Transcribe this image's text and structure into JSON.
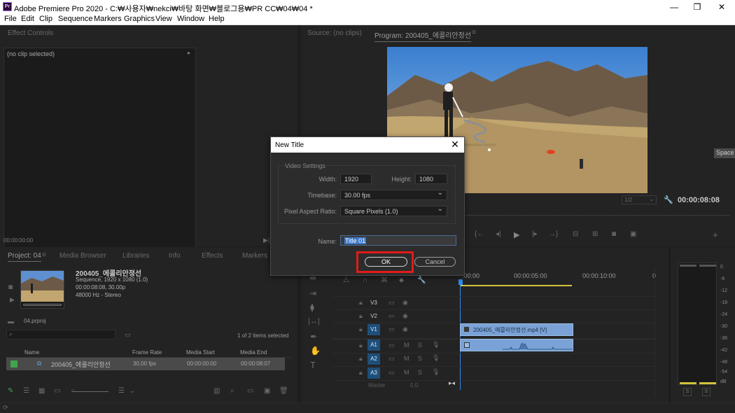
{
  "window": {
    "title": "Adobe Premiere Pro 2020 - C:₩사용자₩nekci₩바탕 화면₩블로그용₩PR CC₩04₩04 *",
    "logo_text": "Pr",
    "minimize": "—",
    "restore": "❐",
    "close": "✕"
  },
  "menu": [
    "File",
    "Edit",
    "Clip",
    "Sequence",
    "Markers",
    "Graphics",
    "View",
    "Window",
    "Help"
  ],
  "effect_controls": {
    "tab": "Effect Controls",
    "no_clip": "(no clip selected)",
    "timecode": "00:00:00:00"
  },
  "program": {
    "source_tab": "Source: (no clips)",
    "program_tab": "Program: 200405_에콜리안정선",
    "zoom": "1/2",
    "timecode": "00:00:08:08",
    "workspace_label": "Space"
  },
  "project": {
    "tabs": [
      "Project: 04",
      "Media Browser",
      "Libraries",
      "Info",
      "Effects",
      "Markers"
    ],
    "sequence_name": "200405_에콜리안정선",
    "sequence_info": [
      "Sequence, 1920 x 1080 (1.0)",
      "00:00:08:08, 30.00p",
      "48000 Hz - Stereo"
    ],
    "file_name": "04.prproj",
    "selection_count": "1 of 2 items selected",
    "columns": [
      "Name",
      "Frame Rate",
      "Media Start",
      "Media End"
    ],
    "rows": [
      {
        "name": "200405_에콜리안정선",
        "frame_rate": "30.00 fps",
        "media_start": "00:00:00:00",
        "media_end": "00:00:08:07"
      }
    ]
  },
  "timeline": {
    "ruler": [
      ":00:00",
      "00:00:05:00",
      "00:00:10:00"
    ],
    "tracks": [
      {
        "id": "V3",
        "target": false
      },
      {
        "id": "V2",
        "target": false
      },
      {
        "id": "V1",
        "target": true
      },
      {
        "id": "A1",
        "target": true
      },
      {
        "id": "A2",
        "target": true
      },
      {
        "id": "A3",
        "target": true
      }
    ],
    "master_label": "Master",
    "master_value": "0.0",
    "video_clip": "200405_에콜리안정선.mp4 [V]"
  },
  "meter": {
    "ticks": [
      "0",
      "-6",
      "-12",
      "-18",
      "-24",
      "-30",
      "-36",
      "-42",
      "-48",
      "-54",
      "dB"
    ],
    "solo_buttons": [
      "S",
      "S"
    ]
  },
  "dialog": {
    "title": "New Title",
    "close": "✕",
    "group_label": "Video Settings",
    "width_label": "Width:",
    "width_value": "1920",
    "height_label": "Height:",
    "height_value": "1080",
    "timebase_label": "Timebase:",
    "timebase_value": "30.00 fps",
    "par_label": "Pixel Aspect Ratio:",
    "par_value": "Square Pixels (1.0)",
    "name_label": "Name:",
    "name_value": "Title 01",
    "ok_label": "OK",
    "cancel_label": "Cancel"
  },
  "colors": {
    "accent_blue": "#1d4f7a",
    "clip_blue": "#7aa2d6",
    "playhead_blue": "#2d8ceb",
    "highlight_red": "#e31a1a"
  }
}
